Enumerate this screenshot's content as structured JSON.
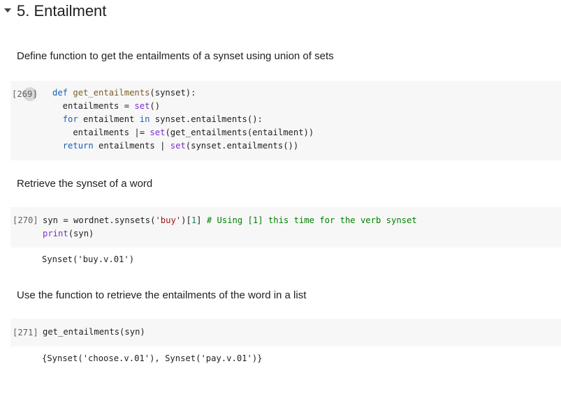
{
  "section": {
    "title": "5. Entailment"
  },
  "markdown": [
    "Define function to get the entailments of a synset using union of sets",
    "Retrieve the synset of a word",
    "Use the function to retrieve the entailments of the word in a list"
  ],
  "cells": [
    {
      "exec": "[269]",
      "lines": [
        "def get_entailments(synset):",
        "  entailments = set()",
        "  for entailment in synset.entailments():",
        "    entailments |= set(get_entailments(entailment))",
        "  return entailments | set(synset.entailments())"
      ],
      "output": ""
    },
    {
      "exec": "[270]",
      "lines": [
        "syn = wordnet.synsets('buy')[1] # Using [1] this time for the verb synset",
        "print(syn)"
      ],
      "output": "Synset('buy.v.01')"
    },
    {
      "exec": "[271]",
      "lines": [
        "get_entailments(syn)"
      ],
      "output": "{Synset('choose.v.01'), Synset('pay.v.01')}"
    }
  ]
}
